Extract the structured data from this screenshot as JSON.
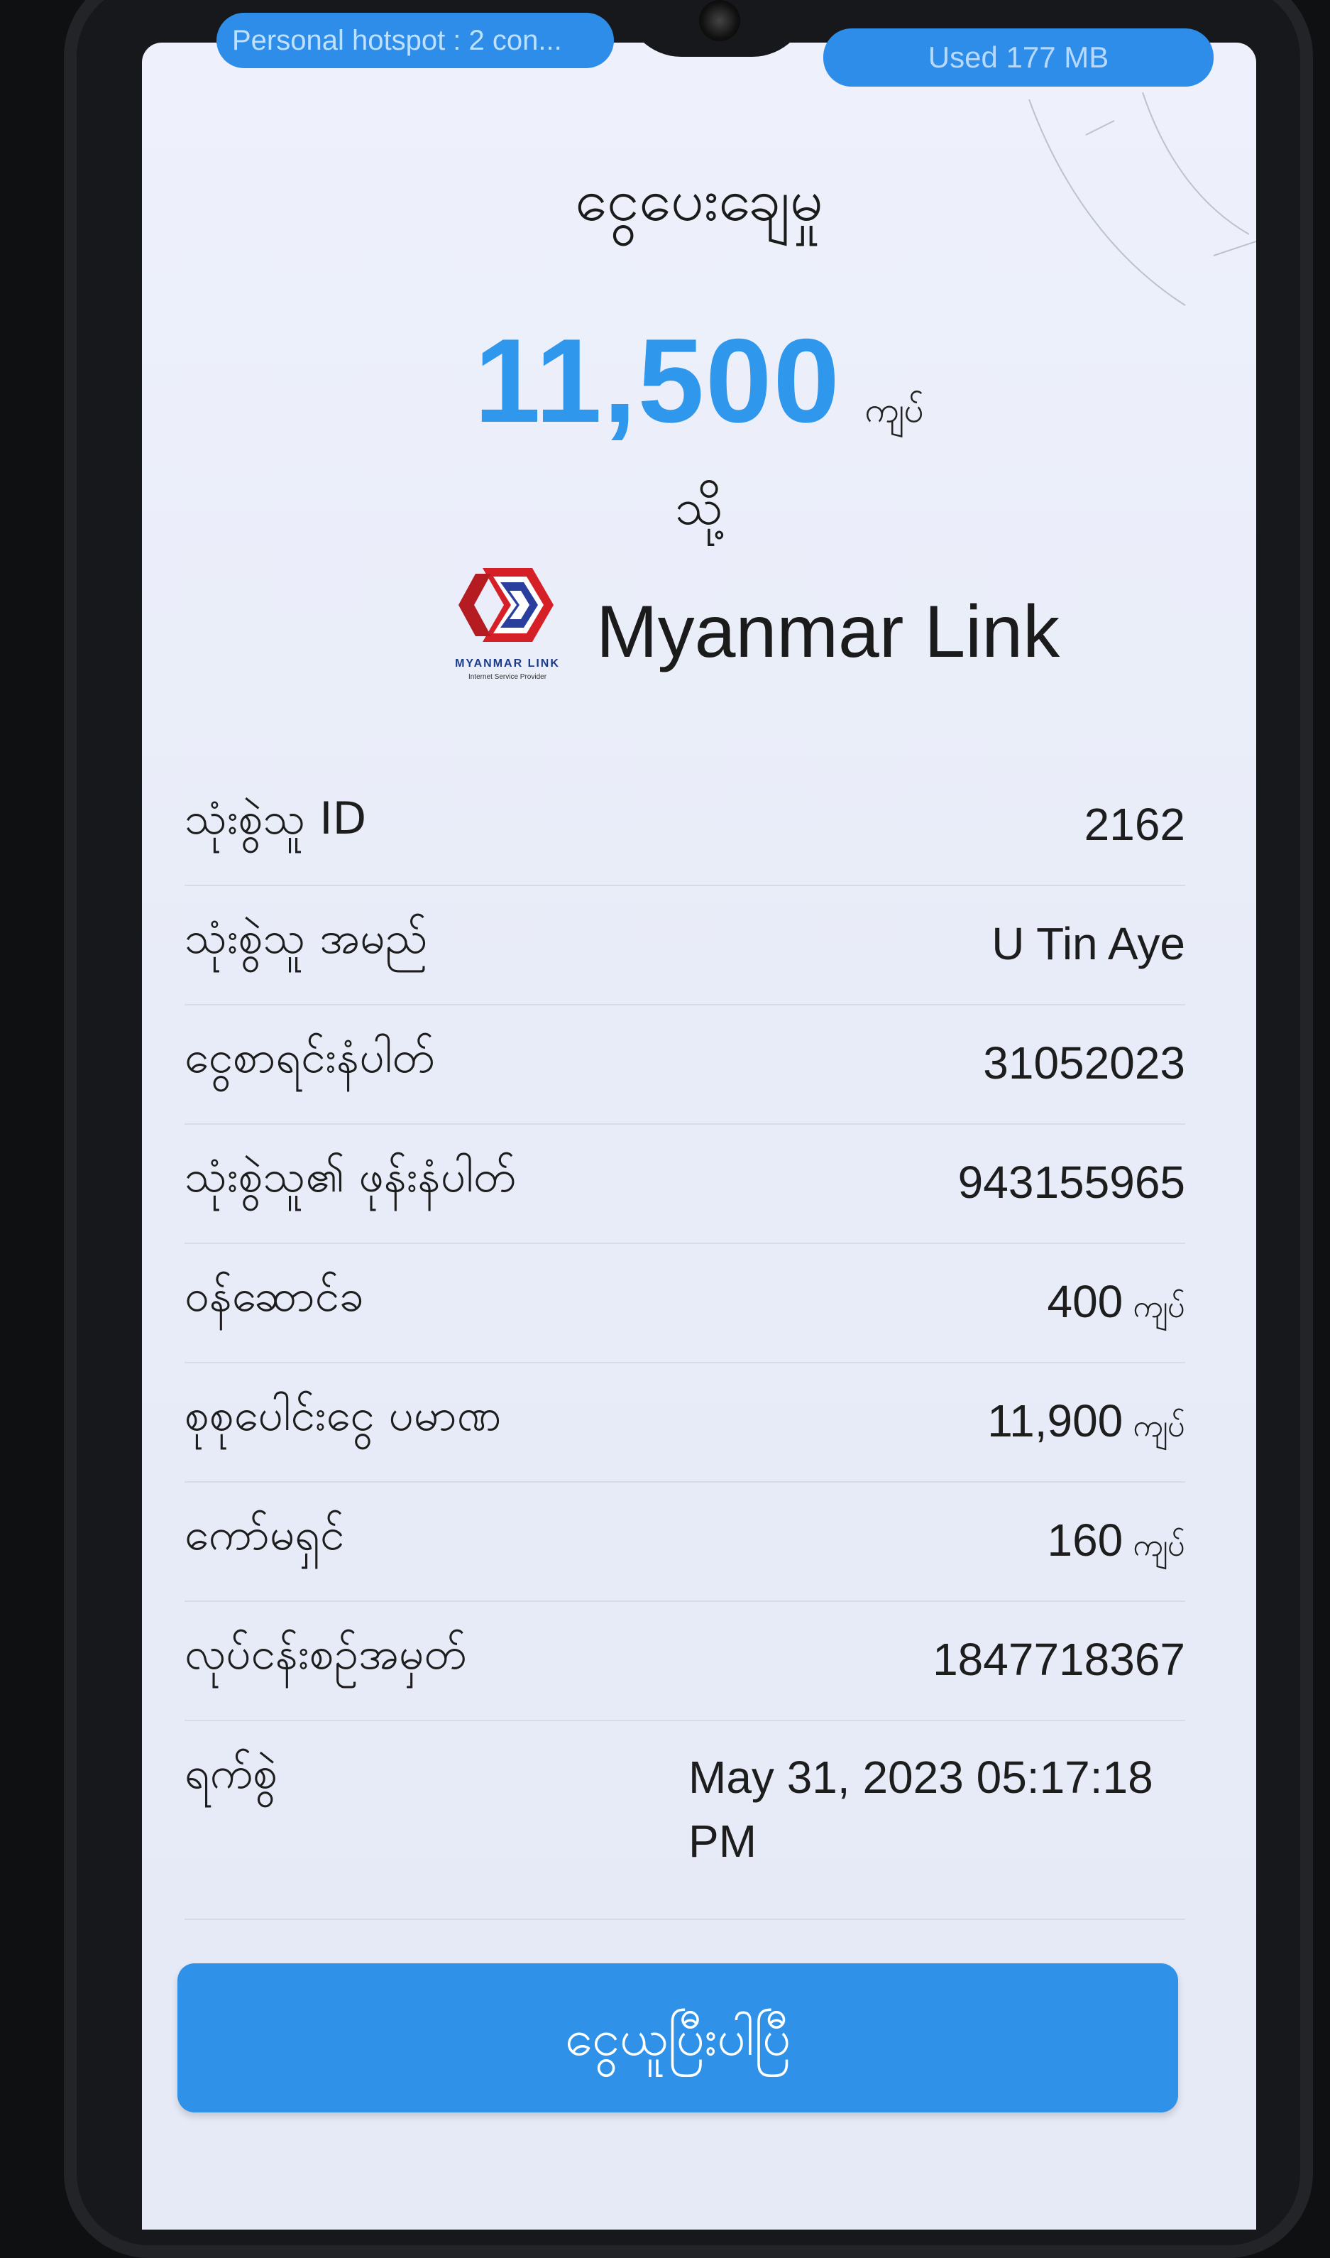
{
  "status_bar": {
    "hotspot_text": "Personal hotspot : 2 con...",
    "data_usage_text": "Used  177 MB"
  },
  "payment": {
    "title": "ငွေပေးချေမှု",
    "amount": "11,500",
    "amount_unit": "ကျပ်",
    "to_label": "သို့",
    "biller_name": "Myanmar Link",
    "logo_caption": "MYANMAR LINK",
    "logo_subcaption": "Internet Service Provider"
  },
  "details": [
    {
      "label": "သုံးစွဲသူ ID",
      "value": "2162",
      "unit": ""
    },
    {
      "label": "သုံးစွဲသူ အမည်",
      "value": "U Tin Aye",
      "unit": ""
    },
    {
      "label": "ငွေစာရင်းနံပါတ်",
      "value": "31052023",
      "unit": ""
    },
    {
      "label": "သုံးစွဲသူ၏ ဖုန်းနံပါတ်",
      "value": "943155965",
      "unit": ""
    },
    {
      "label": "ဝန်ဆောင်ခ",
      "value": "400",
      "unit": "ကျပ်"
    },
    {
      "label": "စုစုပေါင်းငွေ ပမာဏ",
      "value": "11,900",
      "unit": "ကျပ်"
    },
    {
      "label": "ကော်မရှင်",
      "value": "160",
      "unit": "ကျပ်"
    },
    {
      "label": "လုပ်ငန်းစဉ်အမှတ်",
      "value": "1847718367",
      "unit": ""
    },
    {
      "label": "ရက်စွဲ",
      "value": "May 31, 2023 05:17:18 PM",
      "unit": ""
    }
  ],
  "confirm_button_label": "ငွေယူပြီးပါပြီ",
  "colors": {
    "accent": "#2f92e8",
    "amount": "#2f97ec",
    "logo_red": "#d62027",
    "logo_blue": "#2a3f9d"
  }
}
